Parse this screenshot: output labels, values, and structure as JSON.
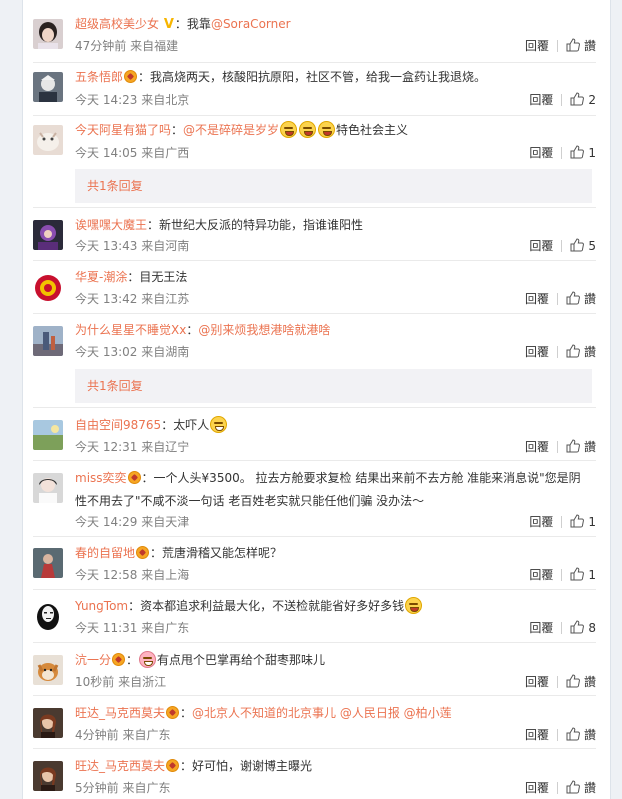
{
  "comments": [
    {
      "user": "超级高校美少女",
      "badge": "V",
      "sep": "：",
      "text": "我靠",
      "mention": "@SoraCorner",
      "time": "47分钟前 来自福建",
      "reply": "回覆",
      "like": "讚",
      "avatar": "girl-portrait"
    },
    {
      "user": "五条悟郎",
      "badge": "vip",
      "sep": "：",
      "text": "我高烧两天，核酸阳抗原阳，社区不管，给我一盒药让我退烧。",
      "time": "今天 14:23 来自北京",
      "reply": "回覆",
      "like": "2",
      "avatar": "character-avatar"
    },
    {
      "user": "今天阿星有猫了吗",
      "sep": "：",
      "mention": "@不是碎碎是岁岁",
      "emoji_count": "3",
      "text": "特色社会主义",
      "time": "今天 14:05 来自广西",
      "reply": "回覆",
      "like": "1",
      "avatar": "cat-photo"
    },
    {
      "user": "诶嘿嘿大魔王",
      "sep": "：",
      "text": "新世纪大反派的特异功能，指谁谁阳性",
      "time": "今天 13:43 来自河南",
      "reply": "回覆",
      "like": "5",
      "avatar": "purple-character"
    },
    {
      "user": "华夏-潮涂",
      "sep": "：",
      "text": "目无王法",
      "time": "今天 13:42 来自江苏",
      "reply": "回覆",
      "like": "讚",
      "avatar": "emblem"
    },
    {
      "user": "为什么星星不睡觉Xx",
      "sep": "：",
      "mention": "@别来烦我想港啥就港啥",
      "time": "今天 13:02 来自湖南",
      "reply": "回覆",
      "like": "讚",
      "avatar": "street-photo"
    },
    {
      "user": "自由空间98765",
      "sep": "：",
      "text": "太吓人",
      "time": "今天 12:31 来自辽宁",
      "reply": "回覆",
      "like": "讚",
      "avatar": "landscape"
    },
    {
      "user": "miss奕奕",
      "badge": "vip",
      "sep": "：",
      "text": "一个人头¥3500。 拉去方舱要求复检 结果出来前不去方舱 准能来消息说\"您是阴性不用去了\"不咸不淡一句话 老百姓老实就只能任他们骗 没办法～",
      "time": "今天 14:29 来自天津",
      "reply": "回覆",
      "like": "1",
      "avatar": "girl-white"
    },
    {
      "user": "春的自留地",
      "badge": "vip",
      "sep": "：",
      "text": "荒唐滑稽又能怎样呢？",
      "time": "今天 12:58 来自上海",
      "reply": "回覆",
      "like": "1",
      "avatar": "red-figure"
    },
    {
      "user": "YungTom",
      "sep": "：",
      "text": "资本都追求利益最大化，不送检就能省好多好多钱",
      "time": "今天 11:31 来自广东",
      "reply": "回覆",
      "like": "8",
      "avatar": "no-face"
    },
    {
      "user": "沆一分",
      "badge": "vip",
      "sep": "：",
      "text": "有点甩个巴掌再给个甜枣那味儿",
      "time": "10秒前 来自浙江",
      "reply": "回覆",
      "like": "讚",
      "avatar": "shiba-dog"
    },
    {
      "user": "旺达_马克西莫夫",
      "badge": "vip",
      "sep": "：",
      "mention": "@北京人不知道的北京事儿 @人民日报 @柏小莲",
      "time": "4分钟前 来自广东",
      "reply": "回覆",
      "like": "讚",
      "avatar": "wanda"
    },
    {
      "user": "旺达_马克西莫夫",
      "badge": "vip",
      "sep": "：",
      "text": "好可怕，谢谢博主曝光",
      "time": "5分钟前 来自广东",
      "reply": "回覆",
      "like": "讚",
      "avatar": "wanda"
    }
  ],
  "sub_replies": [
    "共1条回复",
    "共1条回复"
  ],
  "colors": {
    "username": "#eb7350",
    "meta": "#808080",
    "background": "#eef1f5"
  }
}
